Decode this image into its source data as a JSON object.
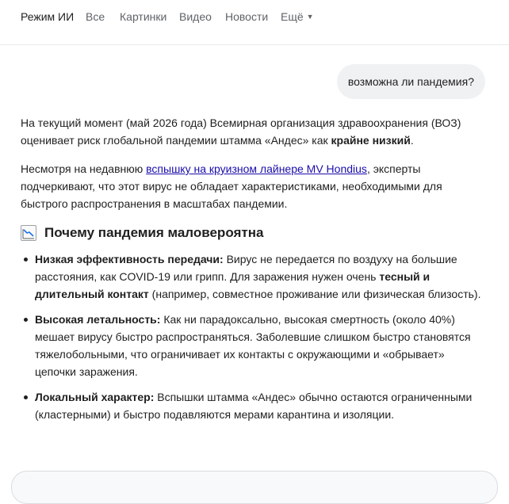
{
  "nav": {
    "tabs": [
      "Режим ИИ",
      "Все",
      "Картинки",
      "Видео",
      "Новости",
      "Ещё"
    ],
    "active_index": 0,
    "more_icon": "caret-down-icon"
  },
  "query": "возможна ли пандемия?",
  "answer": {
    "p1": {
      "text": "На текущий момент (май 2026 года) Всемирная организация здравоохранения (ВОЗ) оценивает риск глобальной пандемии штамма «Андес» как ",
      "bold": "крайне низкий",
      "end": "."
    },
    "p2": {
      "before": "Несмотря на недавнюю ",
      "link": "вспышку на круизном лайнере MV Hondius",
      "after": ", эксперты подчеркивают, что этот вирус не обладает характеристиками, необходимыми для быстрого распространения в масштабах пандемии."
    },
    "heading": {
      "icon": "chart-decreasing-icon",
      "text": "Почему пандемия маловероятна"
    },
    "reasons": [
      {
        "title": "Низкая эффективность передачи:",
        "text": " Вирус не передается по воздуху на большие расстояния, как COVID-19 или грипп. Для заражения нужен очень ",
        "bold": "тесный и длительный контакт",
        "end": " (например, совместное проживание или физическая близость)."
      },
      {
        "title": "Высокая летальность:",
        "text": " Как ни парадоксально, высокая смертность (около 40%) мешает вирусу быстро распространяться. Заболевшие слишком быстро становятся тяжелобольными, что ограничивает их контакты с окружающими и «обрывает» цепочки заражения."
      },
      {
        "title": "Локальный характер:",
        "text": " Вспышки штамма «Андес» обычно остаются ограниченными (кластерными) и быстро подавляются мерами карантина и изоляции."
      }
    ]
  }
}
